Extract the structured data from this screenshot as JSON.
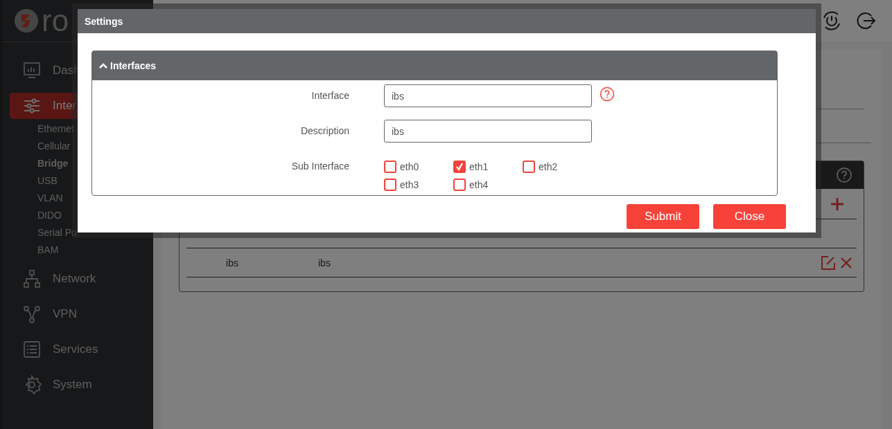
{
  "logo": {
    "text": "ro"
  },
  "sidebar": {
    "items": [
      {
        "label": "Dash",
        "kind": "dashboard",
        "selected": false
      },
      {
        "label": "Inter",
        "kind": "interfaces",
        "selected": true,
        "children": [
          {
            "label": "Ethernet",
            "selected": false
          },
          {
            "label": "Cellular",
            "selected": false
          },
          {
            "label": "Bridge",
            "selected": true
          },
          {
            "label": "USB",
            "selected": false
          },
          {
            "label": "VLAN",
            "selected": false
          },
          {
            "label": "DIDO",
            "selected": false
          },
          {
            "label": "Serial Po",
            "selected": false
          },
          {
            "label": "BAM",
            "selected": false
          }
        ]
      },
      {
        "label": "Network",
        "kind": "network",
        "selected": false
      },
      {
        "label": "VPN",
        "kind": "vpn",
        "selected": false
      },
      {
        "label": "Services",
        "kind": "services",
        "selected": false
      },
      {
        "label": "System",
        "kind": "system",
        "selected": false
      }
    ]
  },
  "table": {
    "rows": [
      {
        "cells": [
          "ibs",
          "ibs"
        ]
      }
    ]
  },
  "modal": {
    "title": "Settings",
    "section": {
      "title": "Interfaces",
      "expanded": true,
      "fields": [
        {
          "label": "Interface",
          "value": "ibs",
          "help": true
        },
        {
          "label": "Description",
          "value": "ibs",
          "help": false
        }
      ],
      "sub_interface": {
        "label": "Sub Interface",
        "options": [
          {
            "label": "eth0",
            "checked": false
          },
          {
            "label": "eth1",
            "checked": true
          },
          {
            "label": "eth2",
            "checked": false
          },
          {
            "label": "eth3",
            "checked": false
          },
          {
            "label": "eth4",
            "checked": false
          }
        ]
      }
    },
    "buttons": [
      "Submit",
      "Close"
    ]
  }
}
